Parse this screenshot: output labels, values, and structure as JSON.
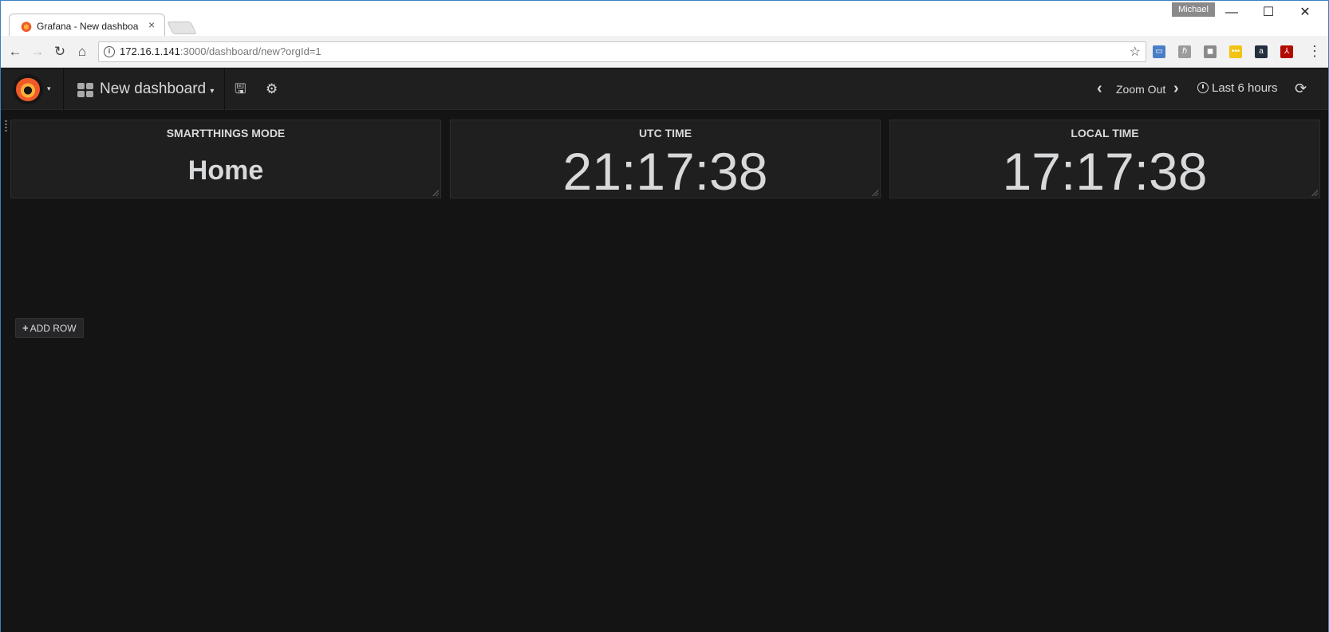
{
  "browser": {
    "tab_title": "Grafana - New dashboard",
    "tab_close": "×",
    "profile_name": "Michael",
    "url_host": "172.16.1.141",
    "url_rest": ":3000/dashboard/new?orgId=1",
    "window_controls": {
      "minimize": "—",
      "maximize": "☐",
      "close": "✕"
    },
    "nav": {
      "back": "←",
      "forward": "→",
      "reload": "↻",
      "home": "⌂"
    },
    "info_icon": "i",
    "bookmark_star": "☆",
    "menu": "⋮",
    "extensions": [
      {
        "name": "cast-icon",
        "color": "#4a7fc8",
        "glyph": "▭"
      },
      {
        "name": "evernote-icon",
        "color": "#9b9b9b",
        "glyph": "ℏ"
      },
      {
        "name": "shield-extension-icon",
        "color": "#8a8a8a",
        "glyph": "◼"
      },
      {
        "name": "keeper-extension-icon",
        "color": "#f2c311",
        "glyph": "•••"
      },
      {
        "name": "amazon-assistant-icon",
        "color": "#232f3e",
        "glyph": "a"
      },
      {
        "name": "adobe-acrobat-icon",
        "color": "#b30b00",
        "glyph": "⅄"
      }
    ]
  },
  "grafana": {
    "dashboard_title": "New dashboard",
    "caret": "▾",
    "save_icon": "🖫",
    "settings_icon": "⚙",
    "zoom_out": "Zoom Out",
    "prev": "‹",
    "next": "›",
    "time_range": "Last 6 hours",
    "refresh_icon": "⟳",
    "panels": [
      {
        "title": "SMARTTHINGS MODE",
        "value": "Home"
      },
      {
        "title": "UTC TIME",
        "value": "21:17:38"
      },
      {
        "title": "LOCAL TIME",
        "value": "17:17:38"
      }
    ],
    "add_row": {
      "plus": "+",
      "label": "ADD ROW"
    }
  }
}
